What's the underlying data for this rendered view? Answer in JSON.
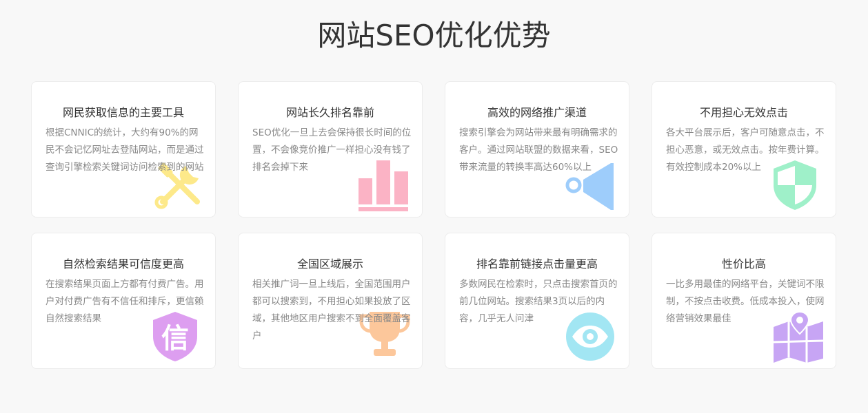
{
  "page": {
    "title": "网站SEO优化优势"
  },
  "cards": [
    {
      "title": "网民获取信息的主要工具",
      "desc": "根据CNNIC的统计，大约有90%的网民不会记忆网址去登陆网站，而是通过查询引擎检索关键词访问检索到的网站",
      "icon": "tools-icon",
      "color": "#fde98a"
    },
    {
      "title": "网站长久排名靠前",
      "desc": "SEO优化一旦上去会保持很长时间的位置，不会像竞价推广一样担心没有钱了排名会掉下来",
      "icon": "bar-chart-icon",
      "color": "#fbb3c5"
    },
    {
      "title": "高效的网络推广渠道",
      "desc": "搜索引擎会为网站带来最有明确需求的客户。通过网站联盟的数据来看，SEO带来流量的转换率高达60%以上",
      "icon": "megaphone-icon",
      "color": "#9ecdfb"
    },
    {
      "title": "不用担心无效点击",
      "desc": "各大平台展示后，客户可随意点击，不担心恶意，或无效点击。按年费计算。有效控制成本20%以上",
      "icon": "shield-icon",
      "color": "#9ff0c9"
    },
    {
      "title": "自然检索结果可信度更高",
      "desc": "在搜索结果页面上方都有付费广告。用户对付费广告有不信任和排斥，更信赖自然搜索结果",
      "icon": "trust-shield-icon",
      "color": "#dd9ef0",
      "glyph": "信"
    },
    {
      "title": "全国区域展示",
      "desc": "相关推广词一旦上线后，全国范围用户都可以搜索到，不用担心如果投放了区域，其他地区用户搜索不到全面覆盖客户",
      "icon": "trophy-icon",
      "color": "#fcc79b"
    },
    {
      "title": "排名靠前链接点击量更高",
      "desc": "多数网民在检索时，只点击搜索首页的前几位网站。搜索结果3页以后的内容，几乎无人问津",
      "icon": "eye-icon",
      "color": "#a2e6f3"
    },
    {
      "title": "性价比高",
      "desc": "一比多用最佳的网络平台，关键词不限制，不按点击收费。低成本投入，使网络营销效果最佳",
      "icon": "map-pin-icon",
      "color": "#c7a5f4"
    }
  ]
}
